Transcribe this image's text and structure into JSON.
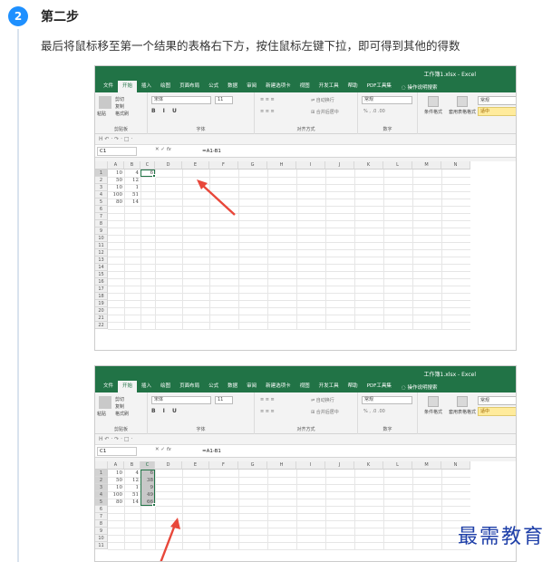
{
  "step": {
    "number": "2",
    "title": "第二步",
    "description": "最后将鼠标移至第一个结果的表格右下方，按住鼠标左键下拉，即可得到其他的得数"
  },
  "excel": {
    "doc_title": "工作簿1.xlsx - Excel",
    "tabs": [
      "文件",
      "开始",
      "插入",
      "绘图",
      "页面布局",
      "公式",
      "数据",
      "审阅",
      "新建选项卡",
      "视图",
      "开发工具",
      "帮助",
      "PDF工具集"
    ],
    "active_tab": "开始",
    "tell_me": "操作说明搜索",
    "clipboard": {
      "paste": "粘贴",
      "cut": "剪切",
      "copy": "复制",
      "painter": "格式刷",
      "name": "剪贴板"
    },
    "font": {
      "family": "宋体",
      "size": "11",
      "name": "字体",
      "format_buttons": "B I U"
    },
    "alignment": {
      "wrap": "自动换行",
      "merge": "合并后居中",
      "name": "对齐方式"
    },
    "number": {
      "format": "常规",
      "symbols": "% , .0 .00",
      "name": "数字"
    },
    "styles": {
      "conditional": "条件格式",
      "table": "套用表格格式",
      "normal": "常规",
      "medium": "适中"
    },
    "qat": "H ↶ · ↷ · □ ·",
    "name_box": "C1",
    "fx_icons": "✕ ✓ fx",
    "formula": "=A1-B1",
    "columns": [
      "A",
      "B",
      "C",
      "D",
      "E",
      "F",
      "G",
      "H",
      "I",
      "J",
      "K",
      "L",
      "M",
      "N"
    ],
    "rows1": [
      "1",
      "2",
      "3",
      "4",
      "5",
      "6",
      "7",
      "8",
      "9",
      "10",
      "11",
      "12",
      "13",
      "14",
      "15",
      "16",
      "17",
      "18",
      "19",
      "20",
      "21",
      "22"
    ],
    "rows2": [
      "1",
      "2",
      "3",
      "4",
      "5",
      "6",
      "7",
      "8",
      "9",
      "10",
      "11"
    ],
    "col_a": [
      "10",
      "50",
      "10",
      "100",
      "80"
    ],
    "col_b": [
      "4",
      "12",
      "1",
      "51",
      "14"
    ],
    "col_c_first": "6",
    "col_c_filled": [
      "6",
      "38",
      "9",
      "49",
      "66"
    ]
  },
  "watermark": "最需教育",
  "colors": {
    "excel_green": "#217346",
    "step_blue": "#1e90ff",
    "arrow_red": "#e8473a"
  }
}
